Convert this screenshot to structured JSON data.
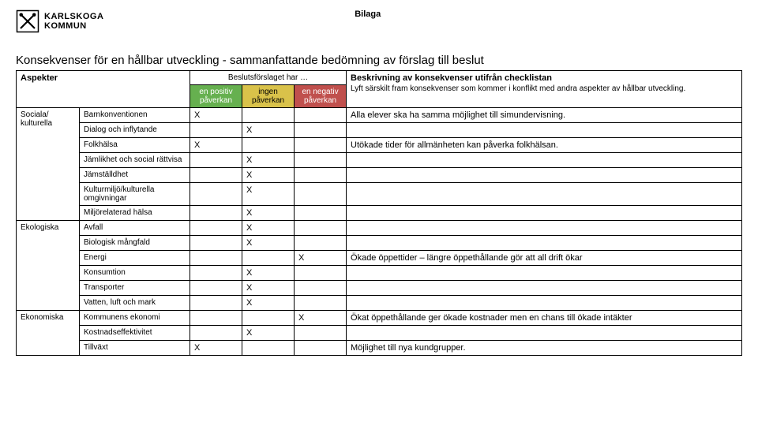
{
  "header": {
    "bilaga": "Bilaga",
    "org_line1": "KARLSKOGA",
    "org_line2": "KOMMUN"
  },
  "title": "Konsekvenser för en hållbar utveckling - sammanfattande bedömning av förslag till beslut",
  "table": {
    "aspekter_label": "Aspekter",
    "beslut_label": "Beslutsförslaget har …",
    "desc_head": "Beskrivning av konsekvenser utifrån checklistan",
    "desc_sub": "Lyft särskilt fram konsekvenser som kommer i konflikt med andra aspekter av hållbar utveckling.",
    "col_pos": "en positiv påverkan",
    "col_ing": "ingen påverkan",
    "col_neg": "en negativ påverkan",
    "groups": [
      {
        "name": "Sociala/ kulturella",
        "rows": [
          {
            "item": "Barnkonventionen",
            "pos": "X",
            "ing": "",
            "neg": "",
            "desc": "Alla elever ska ha samma möjlighet till simundervisning."
          },
          {
            "item": "Dialog och inflytande",
            "pos": "",
            "ing": "X",
            "neg": "",
            "desc": ""
          },
          {
            "item": "Folkhälsa",
            "pos": "X",
            "ing": "",
            "neg": "",
            "desc": "Utökade tider för allmänheten kan påverka folkhälsan."
          },
          {
            "item": "Jämlikhet och social rättvisa",
            "pos": "",
            "ing": "X",
            "neg": "",
            "desc": ""
          },
          {
            "item": "Jämställdhet",
            "pos": "",
            "ing": "X",
            "neg": "",
            "desc": ""
          },
          {
            "item": "Kulturmiljö/kulturella omgivningar",
            "pos": "",
            "ing": "X",
            "neg": "",
            "desc": ""
          },
          {
            "item": "Miljörelaterad hälsa",
            "pos": "",
            "ing": "X",
            "neg": "",
            "desc": ""
          }
        ]
      },
      {
        "name": "Ekologiska",
        "rows": [
          {
            "item": "Avfall",
            "pos": "",
            "ing": "X",
            "neg": "",
            "desc": ""
          },
          {
            "item": "Biologisk mångfald",
            "pos": "",
            "ing": "X",
            "neg": "",
            "desc": ""
          },
          {
            "item": "Energi",
            "pos": "",
            "ing": "",
            "neg": "X",
            "desc": "Ökade öppettider – längre öppethållande gör att all drift ökar"
          },
          {
            "item": "Konsumtion",
            "pos": "",
            "ing": "X",
            "neg": "",
            "desc": ""
          },
          {
            "item": "Transporter",
            "pos": "",
            "ing": "X",
            "neg": "",
            "desc": ""
          },
          {
            "item": "Vatten, luft och mark",
            "pos": "",
            "ing": "X",
            "neg": "",
            "desc": ""
          }
        ]
      },
      {
        "name": "Ekonomiska",
        "rows": [
          {
            "item": "Kommunens ekonomi",
            "pos": "",
            "ing": "",
            "neg": "X",
            "desc": "Ökat öppethållande ger ökade kostnader men en chans till ökade intäkter"
          },
          {
            "item": "Kostnadseffektivitet",
            "pos": "",
            "ing": "X",
            "neg": "",
            "desc": ""
          },
          {
            "item": "Tillväxt",
            "pos": "X",
            "ing": "",
            "neg": "",
            "desc": "Möjlighet till nya kundgrupper."
          }
        ]
      }
    ]
  }
}
